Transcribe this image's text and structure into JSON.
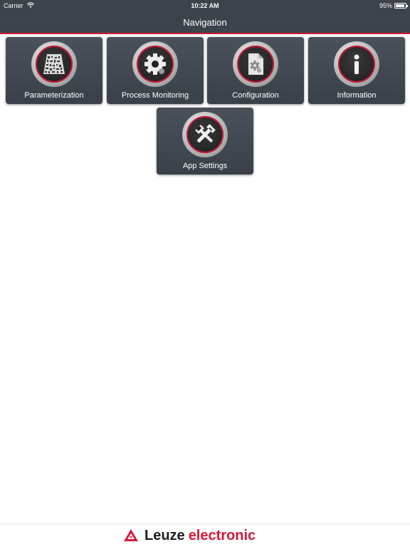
{
  "status_bar": {
    "carrier": "Carrier",
    "time": "10:22 AM",
    "battery": "95%",
    "battery_level": 0.95
  },
  "nav": {
    "title": "Navigation"
  },
  "tiles": [
    {
      "label": "Parameterization",
      "icon": "barcode-icon"
    },
    {
      "label": "Process Monitoring",
      "icon": "gear-icon"
    },
    {
      "label": "Configuration",
      "icon": "config-document-icon"
    },
    {
      "label": "Information",
      "icon": "info-icon"
    },
    {
      "label": "App Settings",
      "icon": "tools-icon"
    }
  ],
  "footer": {
    "brand_main": "Leuze",
    "brand_sub": "electronic"
  },
  "colors": {
    "accent": "#d3183a",
    "header_bg": "#3d434b",
    "tile_bg": "#454b53"
  }
}
